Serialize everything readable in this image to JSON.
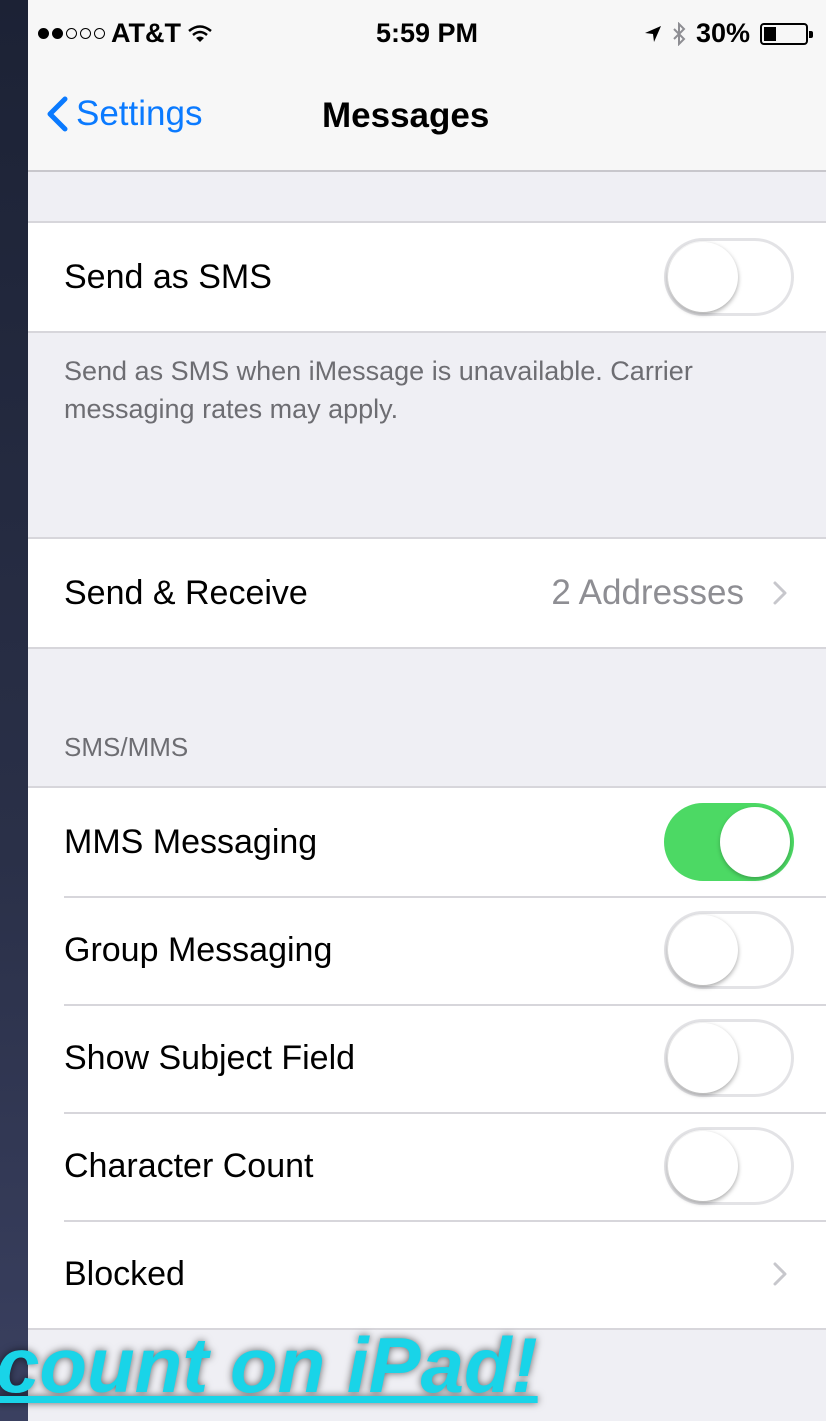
{
  "status_bar": {
    "carrier": "AT&T",
    "time": "5:59 PM",
    "battery": "30%",
    "signal_dots_filled": 2,
    "signal_dots_total": 5,
    "battery_level": 0.3
  },
  "nav": {
    "back_label": "Settings",
    "title": "Messages"
  },
  "send_as_sms": {
    "label": "Send as SMS",
    "enabled": false,
    "footer": "Send as SMS when iMessage is unavailable. Carrier messaging rates may apply."
  },
  "send_receive": {
    "label": "Send & Receive",
    "detail": "2 Addresses"
  },
  "sms_mms": {
    "header": "SMS/MMS",
    "rows": [
      {
        "label": "MMS Messaging",
        "enabled": true
      },
      {
        "label": "Group Messaging",
        "enabled": false
      },
      {
        "label": "Show Subject Field",
        "enabled": false
      },
      {
        "label": "Character Count",
        "enabled": false
      },
      {
        "label": "Blocked"
      }
    ]
  },
  "promo_text": "count on iPad!",
  "colors": {
    "accent": "#0a7aff",
    "toggle_on": "#4cd964",
    "promo": "#19d4e8"
  }
}
